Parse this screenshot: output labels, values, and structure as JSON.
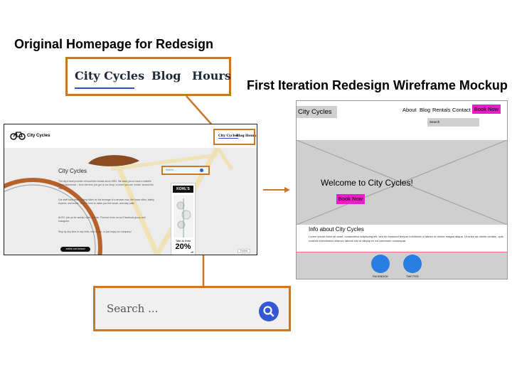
{
  "titles": {
    "original": "Original Homepage for Redesign",
    "wireframe": "First Iteration Redesign Wireframe Mockup"
  },
  "zoom_nav": {
    "items": [
      "City Cycles",
      "Blog",
      "Hours"
    ]
  },
  "zoom_search": {
    "placeholder": "Search ..."
  },
  "original_site": {
    "logo": "City Cycles",
    "nav": [
      "City Cycles",
      "Blog",
      "Hours"
    ],
    "hero_title": "City Cycles",
    "paragraphs": [
      "The city's best provider of local bike rentals since 1983. We want you to have a wheelie great experience – from the time you get to our shop, to when you are 'cruisin' around the city.",
      "Our staff have been renting bikes for the average of a decade now. We know bikes, safety experts, and locals. They're here to make you feel smart, and stay safe!",
      "ALSO: join us for weekly rides, events. Find out more on our Facebook group and Instagram.",
      "Stop by any time to say hello, rent a bike, or just enjoy our company!"
    ],
    "cta": "online cart ahead",
    "search_placeholder": "Search ...",
    "ad": {
      "brand": "KOHL'S",
      "line": "Take an extra",
      "big": "20%",
      "small": "off"
    },
    "follow": "Follow"
  },
  "wireframe": {
    "logo": "City Cycles",
    "nav": [
      "About",
      "Blog",
      "Rentals",
      "Contact"
    ],
    "book_label": "Book Now",
    "search_label": "Search",
    "welcome": "Welcome to City Cycles!",
    "info_title": "Info about City Cycles",
    "info_text": "Lorem ipsum dolor sit amet, consectetur adipiscing elit, sed do eiusmod tempor incididunt ut labore et dolore magna aliqua. Ut enim ad minim veniam, quis nostrud exercitation ullamco laboris nisi ut aliquip ex ea commodo consequat.",
    "footer": [
      "FACEBOOK",
      "TWITTER"
    ]
  },
  "colors": {
    "highlight": "#c8782a",
    "accent": "#e81ec6",
    "social": "#2a7de1",
    "search_button": "#3457d5"
  }
}
